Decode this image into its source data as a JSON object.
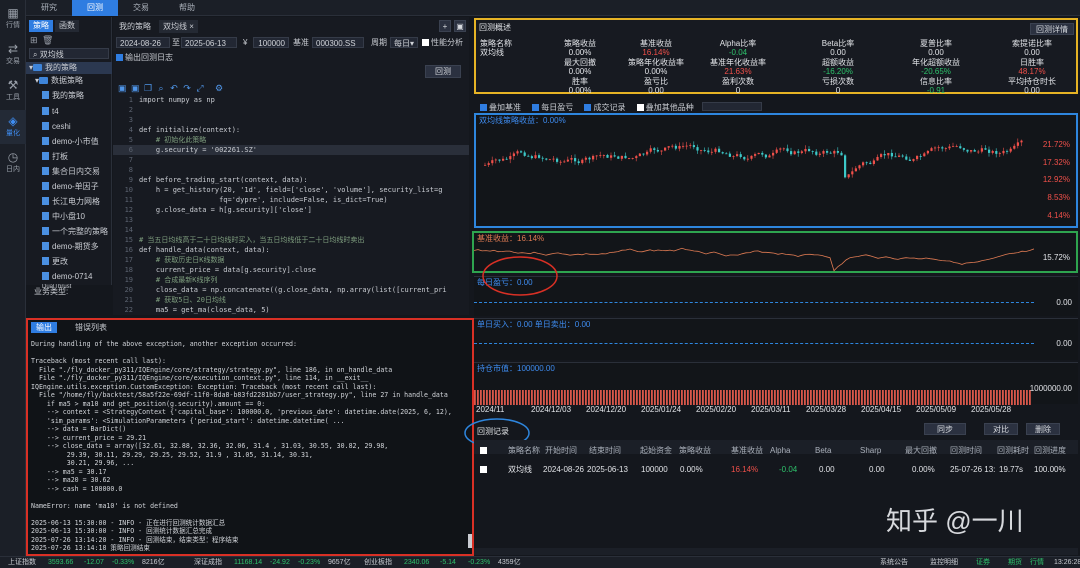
{
  "rail": [
    {
      "label": "行情",
      "icon": "chart-icon"
    },
    {
      "label": "交易",
      "icon": "exchange-icon"
    },
    {
      "label": "工具",
      "icon": "tools-icon"
    },
    {
      "label": "量化",
      "icon": "quant-icon"
    },
    {
      "label": "日内",
      "icon": "intraday-icon"
    }
  ],
  "topbar": {
    "tabs": [
      "研究",
      "回测",
      "交易",
      "帮助"
    ]
  },
  "tree": {
    "tabs": [
      "策略",
      "函数"
    ],
    "search": "双均线",
    "items": [
      "我的策略",
      "数据策略",
      "我的策略",
      "t4",
      "ceshi",
      "demo-小市值",
      "打板",
      "集合日内交易",
      "demo-单因子",
      "长江电力网格",
      "中小盘10",
      "一个完整的策略",
      "demo-期货多",
      "更改",
      "demo-0714",
      "DualThrust",
      ""
    ],
    "label_bizType": "业务类型:"
  },
  "editor": {
    "tabs": [
      "我的策略",
      "双均线"
    ],
    "start": "2024-08-26",
    "to": "至",
    "end": "2025-06-13",
    "yen": "¥",
    "capital": "100000",
    "bench_label": "基准",
    "bench": "000300.SS",
    "period_label": "周期",
    "period": "每日",
    "perf_label": "性能分析",
    "log_label": "输出回测日志",
    "run": "回测",
    "lines": [
      [
        "1",
        "import numpy as np"
      ],
      [
        "2",
        ""
      ],
      [
        "3",
        ""
      ],
      [
        "4",
        "def initialize(context):"
      ],
      [
        "5",
        "    # 初始化此策略"
      ],
      [
        "6",
        "    g.security = '002261.SZ'"
      ],
      [
        "7",
        ""
      ],
      [
        "8",
        ""
      ],
      [
        "9",
        "def before_trading_start(context, data):"
      ],
      [
        "10",
        "    h = get_history(20, '1d', field=['close', 'volume'], security_list=g"
      ],
      [
        "11",
        "                   fq='dypre', include=False, is_dict=True)"
      ],
      [
        "12",
        "    g.close_data = h[g.security]['close']"
      ],
      [
        "13",
        ""
      ],
      [
        "14",
        ""
      ],
      [
        "15",
        "# 当五日均线高于二十日均线时买入，当五日均线低于二十日均线时卖出"
      ],
      [
        "16",
        "def handle_data(context, data):"
      ],
      [
        "17",
        "    # 获取历史日K线数据"
      ],
      [
        "18",
        "    current_price = data[g.security].close"
      ],
      [
        "19",
        "    # 合成最新K线序列"
      ],
      [
        "20",
        "    close_data = np.concatenate((g.close_data, np.array(list([current_pri"
      ],
      [
        "21",
        "    # 获取5日、20日均线"
      ],
      [
        "22",
        "    ma5 = get_ma(close_data, 5)"
      ],
      [
        "23",
        "    ma20 = get_ma(close_data, 20)"
      ],
      [
        "24",
        "    # 得到当前资金余额"
      ]
    ]
  },
  "output": {
    "tabs": [
      "输出",
      "错误列表"
    ],
    "lines": [
      "During handling of the above exception, another exception occurred:",
      "",
      "Traceback (most recent call last):",
      "  File \"./fly_docker_py311/IQEngine/core/strategy/strategy.py\", line 186, in on_handle_data",
      "  File \"./fly_docker_py311/IQEngine/core/execution_context.py\", line 114, in __exit__",
      "IQEngine.utils.exception.CustomException: Exception: Traceback (most recent call last):",
      "  File \"/home/fly/backtest/58a5f22e-69df-11f0-8da8-b83fd2281bb7/user_strategy.py\", line 27 in handle_data",
      "    if ma5 > ma10 and get_position(g.security).amount == 0:",
      "    --> context = <StrategyContext {'capital_base': 100000.0, 'previous_date': datetime.date(2025, 6, 12),",
      "    'sim_params': <SimulationParameters {'period_start': datetime.datetime( ...",
      "    --> data = BarDict()",
      "    --> current_price = 29.21",
      "    --> close_data = array([32.61, 32.88, 32.36, 32.06, 31.4 , 31.03, 30.55, 30.82, 29.98,",
      "         29.39, 30.11, 29.29, 29.25, 29.52, 31.9 , 31.05, 31.14, 30.31,",
      "         30.21, 29.96, ...",
      "    --> ma5 = 30.17",
      "    --> ma20 = 30.62",
      "    --> cash = 100000.0",
      "",
      "NameError: name 'ma10' is not defined",
      "",
      "2025-06-13 15:30:00 - INFO - 正在进行回测统计数据汇总",
      "2025-06-13 15:30:00 - INFO - 回测统计数据汇总完成",
      "2025-07-26 13:14:20 - INFO - 回测结束，结束类型：程序结束",
      "2025-07-26 13:14:18 策略回测结束"
    ]
  },
  "summary": {
    "title": "回测概述",
    "detail": "回测详情",
    "row1": [
      [
        "策略名称",
        "双均线"
      ],
      [
        "策略收益",
        "0.00%"
      ],
      [
        "基准收益",
        "16.14%"
      ],
      [
        "Alpha比率",
        "-0.04"
      ],
      [
        "Beta比率",
        "0.00"
      ],
      [
        "夏普比率",
        "0.00"
      ],
      [
        "索提诺比率",
        "0.00"
      ]
    ],
    "row2": [
      [
        "最大回撤",
        "0.00%"
      ],
      [
        "策略年化收益率",
        "0.00%"
      ],
      [
        "基准年化收益率",
        "21.63%"
      ],
      [
        "超额收益",
        "-16.20%"
      ],
      [
        "年化超额收益",
        "-20.65%"
      ],
      [
        "日胜率",
        "48.17%"
      ]
    ],
    "row3": [
      [
        "胜率",
        "0.00%"
      ],
      [
        "盈亏比",
        "0.00"
      ],
      [
        "盈利次数",
        "0"
      ],
      [
        "亏损次数",
        "0"
      ],
      [
        "信息比率",
        "-0.91"
      ],
      [
        "平均持仓时长",
        "0.00"
      ]
    ]
  },
  "chart_controls": [
    "叠加基准",
    "每日盈亏",
    "成交记录",
    "叠加其他品种"
  ],
  "chart_data": [
    {
      "type": "candlestick",
      "title": "双均线策略收益：0.00%",
      "yticks": [
        "21.72%",
        "17.32%",
        "12.92%",
        "8.53%",
        "4.14%"
      ]
    },
    {
      "type": "line",
      "title": "基准收益：16.14%",
      "value": "15.72%"
    },
    {
      "type": "bar",
      "title": "每日盈亏：0.00",
      "value": "0.00"
    },
    {
      "type": "bar",
      "title": "单日买入：0.00 单日卖出：0.00",
      "value": "0.00"
    },
    {
      "type": "bar",
      "title": "持仓市值：100000.00",
      "value": "1000000.00"
    }
  ],
  "xaxis": [
    "2024/11",
    "2024/12/03",
    "2024/12/20",
    "2025/01/24",
    "2025/02/20",
    "2025/03/11",
    "2025/03/28",
    "2025/04/15",
    "2025/05/09",
    "2025/05/28"
  ],
  "records": {
    "title": "回测记录",
    "buttons": [
      "同步",
      "对比",
      "删除"
    ],
    "headers": [
      "策略名称",
      "开始时间",
      "结束时间",
      "起始资金",
      "策略收益",
      "基准收益",
      "Alpha",
      "Beta",
      "Sharp",
      "最大回撤",
      "回测时间",
      "回测耗时",
      "回测进度"
    ],
    "row": [
      "双均线",
      "2024-08-26",
      "2025-06-13",
      "100000",
      "0.00%",
      "16.14%",
      "-0.04",
      "0.00",
      "0.00",
      "0.00%",
      "25-07-26 13:",
      "19.77s",
      "100.00%"
    ]
  },
  "watermark": "知乎 @一川",
  "status": [
    [
      "上证指数",
      "3593.66",
      "-12.07",
      "-0.33%",
      "8216亿"
    ],
    [
      "深证成指",
      "11168.14",
      "-24.92",
      "-0.23%",
      "9657亿"
    ],
    [
      "创业板指",
      "2340.06",
      "-5.14",
      "-0.23%",
      "4359亿"
    ]
  ],
  "status_right": [
    "系统公告",
    "监控明细",
    "证券",
    "期货",
    "行情",
    "13:26:28"
  ]
}
